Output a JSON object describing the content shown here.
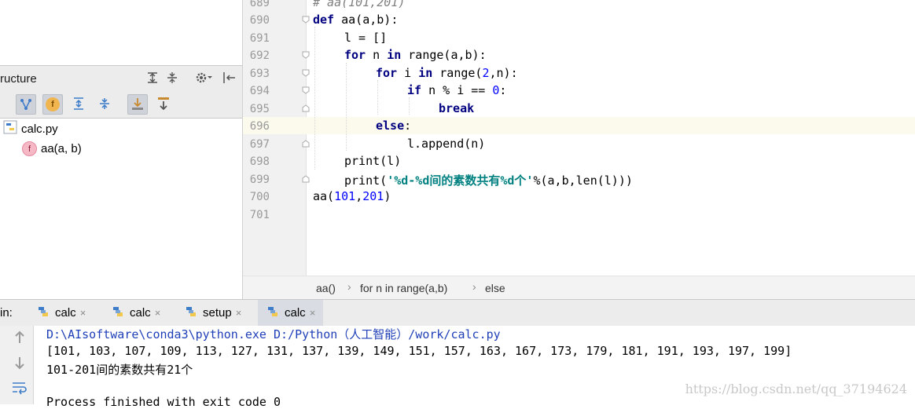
{
  "structure": {
    "title": "ructure",
    "tree": {
      "file": "calc.py",
      "function_badge": "f",
      "function": "aa(a, b)"
    },
    "toolbar_badge": "f"
  },
  "editor": {
    "line_numbers": [
      "689",
      "690",
      "691",
      "692",
      "693",
      "694",
      "695",
      "696",
      "697",
      "698",
      "699",
      "700",
      "701"
    ],
    "line_689": "# aa(101,201)",
    "line_690": {
      "kw": "def",
      "rest": " aa(a,b):"
    },
    "line_691": "l = []",
    "line_692": {
      "kw1": "for",
      "mid": " n ",
      "kw2": "in",
      "rest": " range(a,b):"
    },
    "line_693": {
      "kw1": "for",
      "mid": " i ",
      "kw2": "in",
      "a": " range(",
      "num": "2",
      "b": ",n):"
    },
    "line_694": {
      "kw": "if",
      "a": " n % i == ",
      "num": "0",
      "b": ":"
    },
    "line_695": "break",
    "line_696": {
      "kw": "else",
      "rest": ":"
    },
    "line_697": "l.append(n)",
    "line_698": "print(l)",
    "line_699": {
      "a": "print(",
      "str": "'%d-%d间的素数共有%d个'",
      "b": "%(a,b,len(l)))"
    },
    "line_700": {
      "a": "aa(",
      "n1": "101",
      "c": ",",
      "n2": "201",
      "b": ")"
    }
  },
  "breadcrumb": [
    "aa()",
    "for n in range(a,b)",
    "else"
  ],
  "run": {
    "label": "in:",
    "tabs": [
      {
        "label": "calc"
      },
      {
        "label": "calc"
      },
      {
        "label": "setup"
      },
      {
        "label": "calc"
      }
    ],
    "close_glyph": "×"
  },
  "console": {
    "command": "D:\\AIsoftware\\conda3\\python.exe D:/Python（人工智能）/work/calc.py",
    "output_list": "[101, 103, 107, 109, 113, 127, 131, 137, 139, 149, 151, 157, 163, 167, 173, 179, 181, 191, 193, 197, 199]",
    "output_msg": "101-201间的素数共有21个",
    "exit": "Process finished with exit code 0"
  },
  "watermark": "https://blog.csdn.net/qq_37194624",
  "colors": {
    "keyword": "#000080",
    "number": "#0000ff",
    "string": "#008080",
    "comment": "#808080",
    "console_command": "#1f3fb8",
    "current_line": "#fcfaed"
  }
}
